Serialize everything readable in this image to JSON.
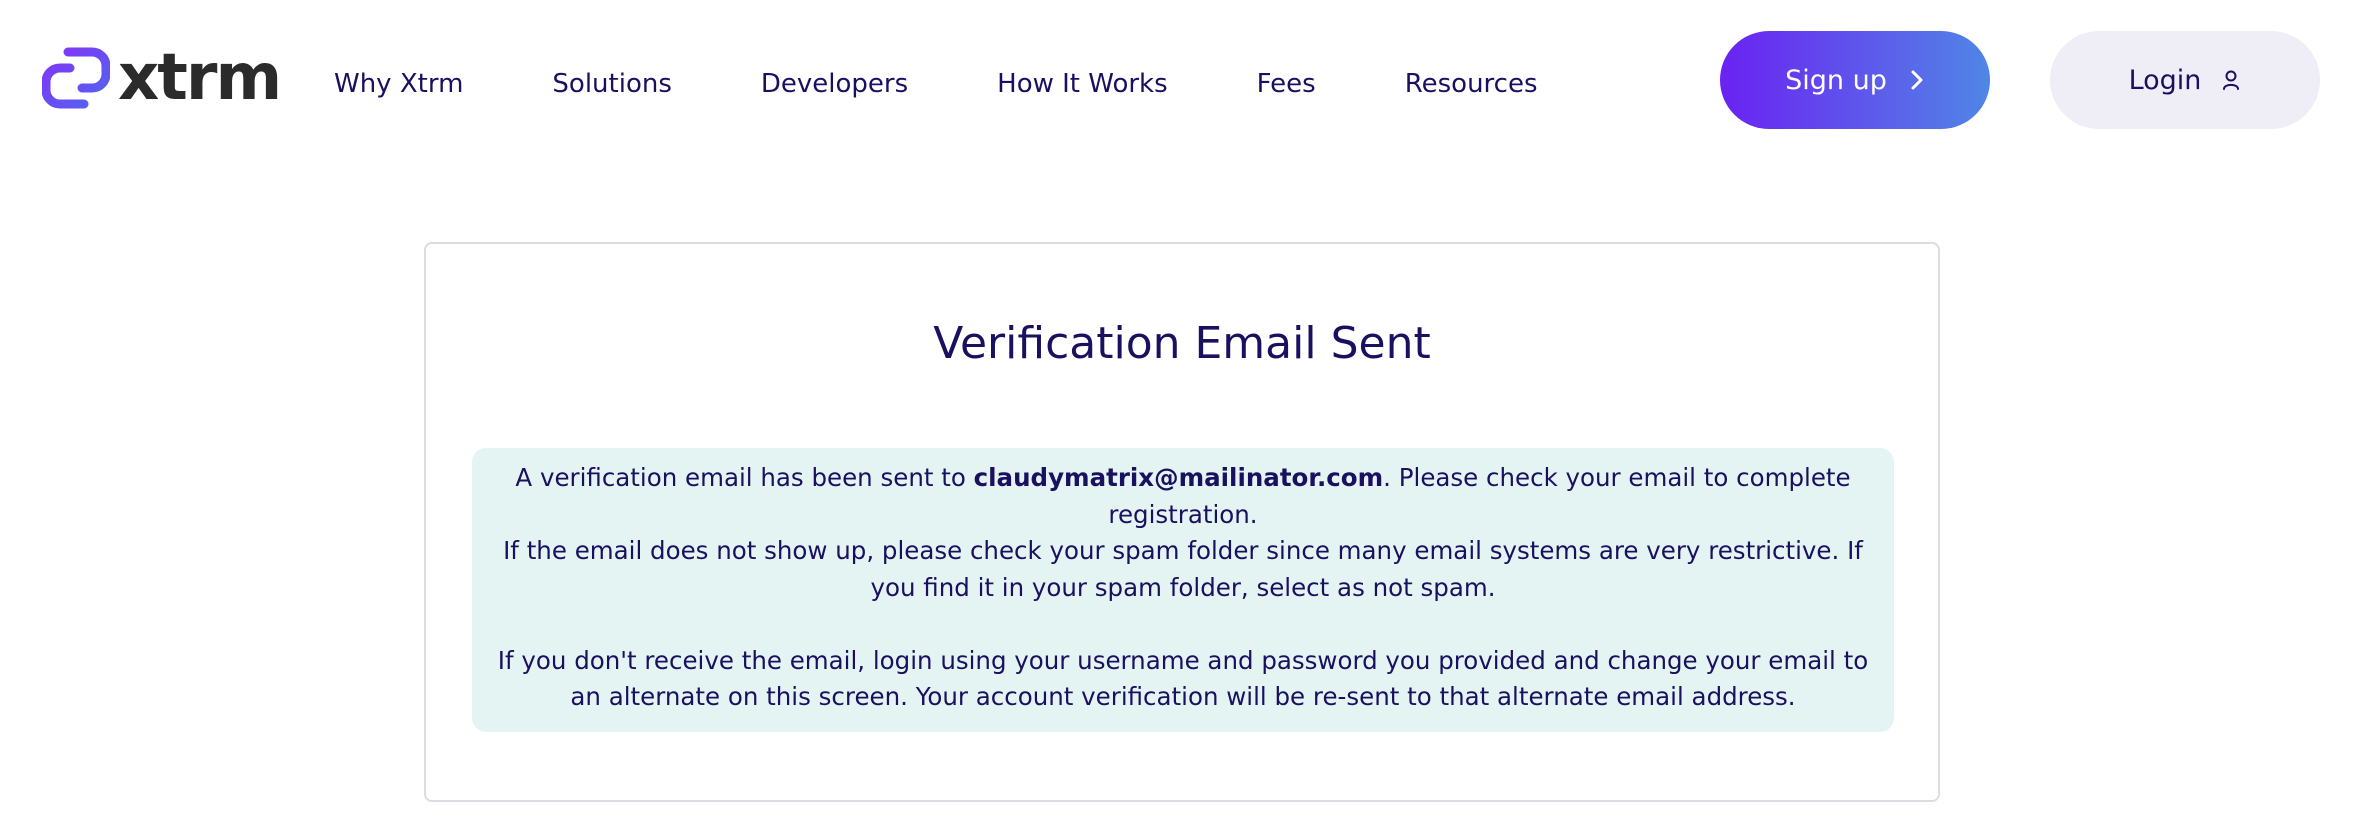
{
  "header": {
    "logo": {
      "text": "xtrm",
      "icon": "xtrm-logo-mark-icon",
      "accent_color": "#6a3df0"
    },
    "nav": [
      {
        "label": "Why Xtrm"
      },
      {
        "label": "Solutions"
      },
      {
        "label": "Developers"
      },
      {
        "label": "How It Works"
      },
      {
        "label": "Fees"
      },
      {
        "label": "Resources"
      }
    ],
    "signup": {
      "label": "Sign up",
      "icon": "chevron-right-icon",
      "gradient": [
        "#6a22f2",
        "#4f86e6"
      ]
    },
    "login": {
      "label": "Login",
      "icon": "user-icon",
      "background": "#efedf5"
    }
  },
  "card": {
    "title": "Verification Email Sent",
    "notice": {
      "background": "#e4f4f2",
      "line1_prefix": "A verification email has been sent to ",
      "email": "claudymatrix@mailinator.com",
      "line1_suffix": ". Please check your email to complete registration.",
      "line2": "If the email does not show up, please check your spam folder since many email systems are very restrictive. If you find it in your spam folder, select as not spam.",
      "line3": "If you don't receive the email, login using your username and password you provided and change your email to an alternate on this screen. Your account verification will be re-sent to that alternate email address."
    }
  },
  "colors": {
    "text_primary": "#1a1060",
    "card_border": "#dcdce3"
  }
}
